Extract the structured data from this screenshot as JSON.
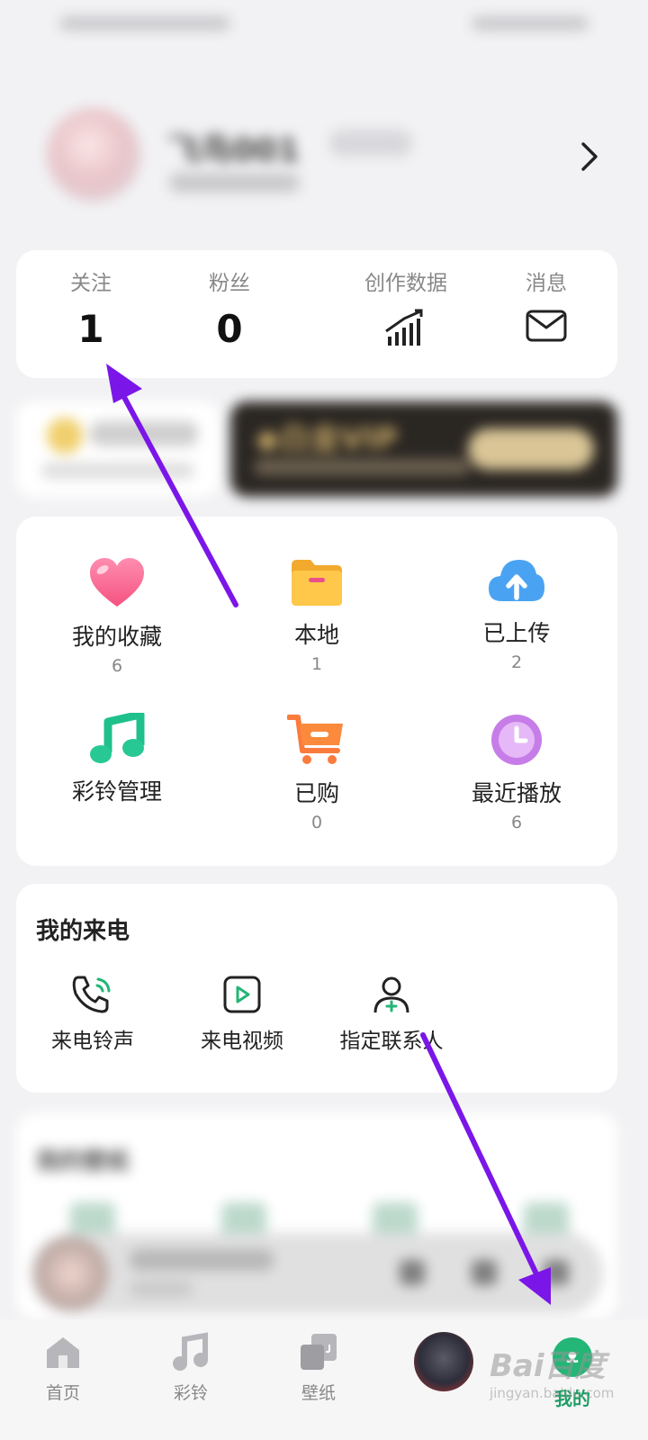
{
  "profile": {
    "nickname": "飞鸟001",
    "chevron_icon": "chevron-right-icon"
  },
  "stats": [
    {
      "label": "关注",
      "value": "1"
    },
    {
      "label": "粉丝",
      "value": "0"
    },
    {
      "label": "创作数据",
      "icon": "chart-bars-icon"
    },
    {
      "label": "消息",
      "icon": "envelope-icon"
    }
  ],
  "vip": {
    "title": "◆白金VIP"
  },
  "grid": [
    {
      "label": "我的收藏",
      "count": "6",
      "icon": "heart-icon"
    },
    {
      "label": "本地",
      "count": "1",
      "icon": "folder-icon"
    },
    {
      "label": "已上传",
      "count": "2",
      "icon": "cloud-upload-icon"
    },
    {
      "label": "彩铃管理",
      "count": "",
      "icon": "music-note-icon"
    },
    {
      "label": "已购",
      "count": "0",
      "icon": "shopping-cart-icon"
    },
    {
      "label": "最近播放",
      "count": "6",
      "icon": "clock-icon"
    }
  ],
  "calls": {
    "title": "我的来电",
    "items": [
      {
        "label": "来电铃声",
        "icon": "phone-ringing-icon"
      },
      {
        "label": "来电视频",
        "icon": "video-play-icon"
      },
      {
        "label": "指定联系人",
        "icon": "add-contact-icon"
      }
    ]
  },
  "lower": {
    "title": "我的壁纸"
  },
  "nav": [
    {
      "label": "首页",
      "icon": "home-icon"
    },
    {
      "label": "彩铃",
      "icon": "music-icon"
    },
    {
      "label": "壁纸",
      "icon": "wallpaper-icon"
    },
    {
      "label": "",
      "icon": "player-avatar"
    },
    {
      "label": "我的",
      "icon": "profile-icon",
      "active": true
    }
  ],
  "watermark": {
    "line1": "Bai百度",
    "line2": "jingyan.baidu.com"
  },
  "colors": {
    "accent_green": "#23b676",
    "arrow_purple": "#7b16e8"
  }
}
